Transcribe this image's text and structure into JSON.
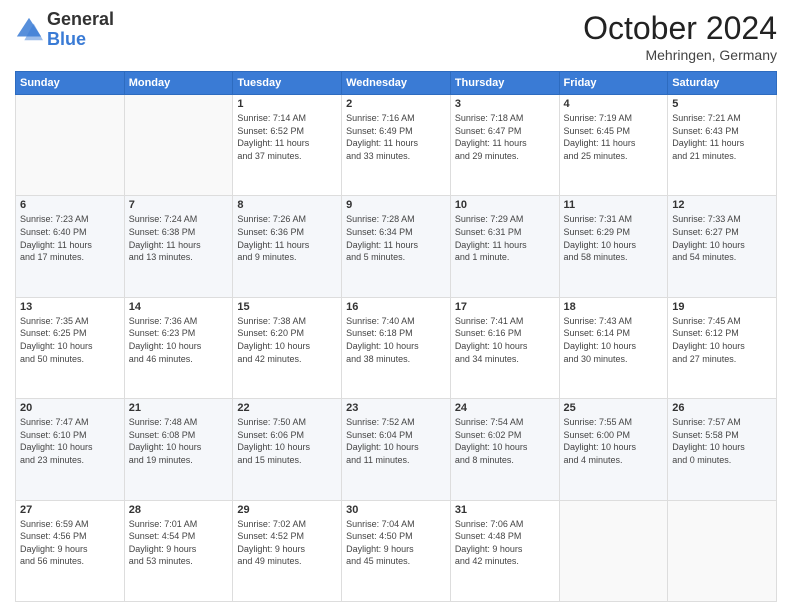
{
  "header": {
    "logo_general": "General",
    "logo_blue": "Blue",
    "month_title": "October 2024",
    "subtitle": "Mehringen, Germany"
  },
  "days_of_week": [
    "Sunday",
    "Monday",
    "Tuesday",
    "Wednesday",
    "Thursday",
    "Friday",
    "Saturday"
  ],
  "weeks": [
    [
      {
        "day": "",
        "info": ""
      },
      {
        "day": "",
        "info": ""
      },
      {
        "day": "1",
        "info": "Sunrise: 7:14 AM\nSunset: 6:52 PM\nDaylight: 11 hours\nand 37 minutes."
      },
      {
        "day": "2",
        "info": "Sunrise: 7:16 AM\nSunset: 6:49 PM\nDaylight: 11 hours\nand 33 minutes."
      },
      {
        "day": "3",
        "info": "Sunrise: 7:18 AM\nSunset: 6:47 PM\nDaylight: 11 hours\nand 29 minutes."
      },
      {
        "day": "4",
        "info": "Sunrise: 7:19 AM\nSunset: 6:45 PM\nDaylight: 11 hours\nand 25 minutes."
      },
      {
        "day": "5",
        "info": "Sunrise: 7:21 AM\nSunset: 6:43 PM\nDaylight: 11 hours\nand 21 minutes."
      }
    ],
    [
      {
        "day": "6",
        "info": "Sunrise: 7:23 AM\nSunset: 6:40 PM\nDaylight: 11 hours\nand 17 minutes."
      },
      {
        "day": "7",
        "info": "Sunrise: 7:24 AM\nSunset: 6:38 PM\nDaylight: 11 hours\nand 13 minutes."
      },
      {
        "day": "8",
        "info": "Sunrise: 7:26 AM\nSunset: 6:36 PM\nDaylight: 11 hours\nand 9 minutes."
      },
      {
        "day": "9",
        "info": "Sunrise: 7:28 AM\nSunset: 6:34 PM\nDaylight: 11 hours\nand 5 minutes."
      },
      {
        "day": "10",
        "info": "Sunrise: 7:29 AM\nSunset: 6:31 PM\nDaylight: 11 hours\nand 1 minute."
      },
      {
        "day": "11",
        "info": "Sunrise: 7:31 AM\nSunset: 6:29 PM\nDaylight: 10 hours\nand 58 minutes."
      },
      {
        "day": "12",
        "info": "Sunrise: 7:33 AM\nSunset: 6:27 PM\nDaylight: 10 hours\nand 54 minutes."
      }
    ],
    [
      {
        "day": "13",
        "info": "Sunrise: 7:35 AM\nSunset: 6:25 PM\nDaylight: 10 hours\nand 50 minutes."
      },
      {
        "day": "14",
        "info": "Sunrise: 7:36 AM\nSunset: 6:23 PM\nDaylight: 10 hours\nand 46 minutes."
      },
      {
        "day": "15",
        "info": "Sunrise: 7:38 AM\nSunset: 6:20 PM\nDaylight: 10 hours\nand 42 minutes."
      },
      {
        "day": "16",
        "info": "Sunrise: 7:40 AM\nSunset: 6:18 PM\nDaylight: 10 hours\nand 38 minutes."
      },
      {
        "day": "17",
        "info": "Sunrise: 7:41 AM\nSunset: 6:16 PM\nDaylight: 10 hours\nand 34 minutes."
      },
      {
        "day": "18",
        "info": "Sunrise: 7:43 AM\nSunset: 6:14 PM\nDaylight: 10 hours\nand 30 minutes."
      },
      {
        "day": "19",
        "info": "Sunrise: 7:45 AM\nSunset: 6:12 PM\nDaylight: 10 hours\nand 27 minutes."
      }
    ],
    [
      {
        "day": "20",
        "info": "Sunrise: 7:47 AM\nSunset: 6:10 PM\nDaylight: 10 hours\nand 23 minutes."
      },
      {
        "day": "21",
        "info": "Sunrise: 7:48 AM\nSunset: 6:08 PM\nDaylight: 10 hours\nand 19 minutes."
      },
      {
        "day": "22",
        "info": "Sunrise: 7:50 AM\nSunset: 6:06 PM\nDaylight: 10 hours\nand 15 minutes."
      },
      {
        "day": "23",
        "info": "Sunrise: 7:52 AM\nSunset: 6:04 PM\nDaylight: 10 hours\nand 11 minutes."
      },
      {
        "day": "24",
        "info": "Sunrise: 7:54 AM\nSunset: 6:02 PM\nDaylight: 10 hours\nand 8 minutes."
      },
      {
        "day": "25",
        "info": "Sunrise: 7:55 AM\nSunset: 6:00 PM\nDaylight: 10 hours\nand 4 minutes."
      },
      {
        "day": "26",
        "info": "Sunrise: 7:57 AM\nSunset: 5:58 PM\nDaylight: 10 hours\nand 0 minutes."
      }
    ],
    [
      {
        "day": "27",
        "info": "Sunrise: 6:59 AM\nSunset: 4:56 PM\nDaylight: 9 hours\nand 56 minutes."
      },
      {
        "day": "28",
        "info": "Sunrise: 7:01 AM\nSunset: 4:54 PM\nDaylight: 9 hours\nand 53 minutes."
      },
      {
        "day": "29",
        "info": "Sunrise: 7:02 AM\nSunset: 4:52 PM\nDaylight: 9 hours\nand 49 minutes."
      },
      {
        "day": "30",
        "info": "Sunrise: 7:04 AM\nSunset: 4:50 PM\nDaylight: 9 hours\nand 45 minutes."
      },
      {
        "day": "31",
        "info": "Sunrise: 7:06 AM\nSunset: 4:48 PM\nDaylight: 9 hours\nand 42 minutes."
      },
      {
        "day": "",
        "info": ""
      },
      {
        "day": "",
        "info": ""
      }
    ]
  ]
}
